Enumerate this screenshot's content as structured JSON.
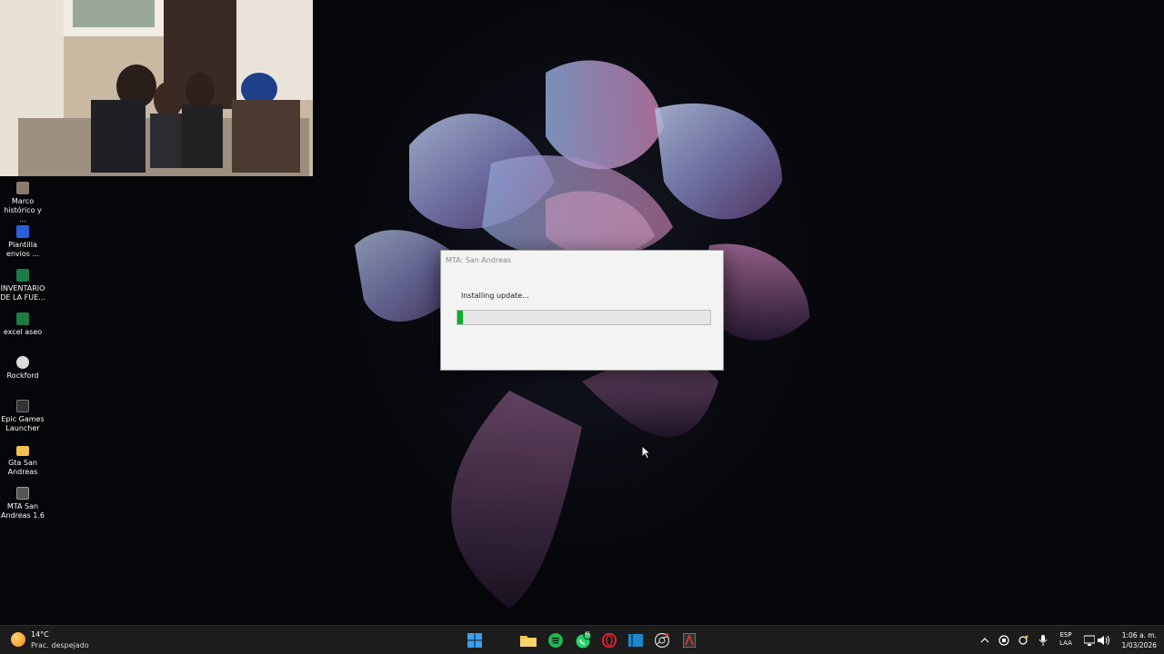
{
  "desktop_icons": [
    {
      "label": "Marco histórico y ...",
      "icon": "image-file-icon",
      "color": "#8a7a6a"
    },
    {
      "label": "Plantilla envios ...",
      "icon": "word-document-icon",
      "color": "#2b5fd9"
    },
    {
      "label": "INVENTARIO DE LA FUE...",
      "icon": "excel-file-icon",
      "color": "#1e7b45"
    },
    {
      "label": "excel aseo",
      "icon": "excel-file-icon",
      "color": "#1e7b45"
    },
    {
      "label": "Rockford",
      "icon": "rockford-app-icon",
      "color": "#dcdcdc"
    },
    {
      "label": "Epic Games Launcher",
      "icon": "epic-games-icon",
      "color": "#333333"
    },
    {
      "label": "Gta San Andreas",
      "icon": "folder-icon",
      "color": "#f2c14e"
    },
    {
      "label": "MTA San Andreas 1.6",
      "icon": "mta-app-icon",
      "color": "#555555"
    }
  ],
  "dialog": {
    "title": "MTA: San Andreas",
    "message": "Installing update...",
    "progress": 0.02
  },
  "taskbar": {
    "weather": {
      "temperature": "14°C",
      "condition": "Prac. despejado"
    },
    "apps": [
      "windows-start-icon",
      "file-explorer-icon",
      "spotify-icon",
      "whatsapp-icon",
      "opera-icon",
      "app-icon",
      "chrome-icon",
      "mta-taskbar-icon"
    ],
    "whatsapp_badge": "41",
    "language": {
      "line1": "ESP",
      "line2": "LAA"
    },
    "time": "1:06 a. m.",
    "date": "1/03/2026"
  },
  "colors": {
    "progress_fill": "#06b025",
    "taskbar": "#1c1c1c",
    "dialog_bg": "#f3f3f3"
  }
}
